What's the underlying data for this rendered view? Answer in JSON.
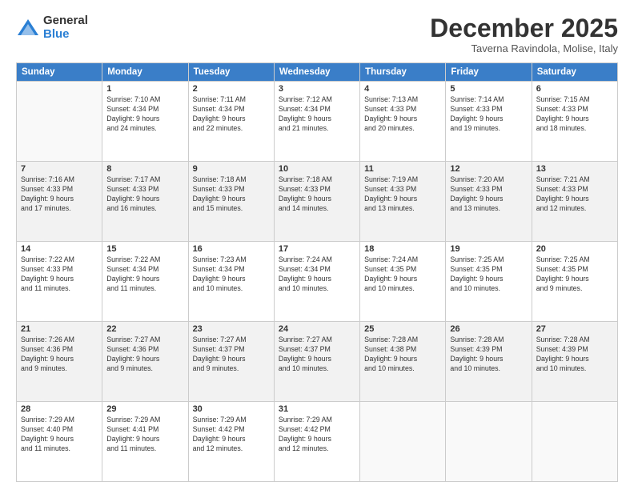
{
  "logo": {
    "general": "General",
    "blue": "Blue"
  },
  "header": {
    "month": "December 2025",
    "location": "Taverna Ravindola, Molise, Italy"
  },
  "weekdays": [
    "Sunday",
    "Monday",
    "Tuesday",
    "Wednesday",
    "Thursday",
    "Friday",
    "Saturday"
  ],
  "weeks": [
    [
      {
        "day": "",
        "info": ""
      },
      {
        "day": "1",
        "info": "Sunrise: 7:10 AM\nSunset: 4:34 PM\nDaylight: 9 hours\nand 24 minutes."
      },
      {
        "day": "2",
        "info": "Sunrise: 7:11 AM\nSunset: 4:34 PM\nDaylight: 9 hours\nand 22 minutes."
      },
      {
        "day": "3",
        "info": "Sunrise: 7:12 AM\nSunset: 4:34 PM\nDaylight: 9 hours\nand 21 minutes."
      },
      {
        "day": "4",
        "info": "Sunrise: 7:13 AM\nSunset: 4:33 PM\nDaylight: 9 hours\nand 20 minutes."
      },
      {
        "day": "5",
        "info": "Sunrise: 7:14 AM\nSunset: 4:33 PM\nDaylight: 9 hours\nand 19 minutes."
      },
      {
        "day": "6",
        "info": "Sunrise: 7:15 AM\nSunset: 4:33 PM\nDaylight: 9 hours\nand 18 minutes."
      }
    ],
    [
      {
        "day": "7",
        "info": "Sunrise: 7:16 AM\nSunset: 4:33 PM\nDaylight: 9 hours\nand 17 minutes."
      },
      {
        "day": "8",
        "info": "Sunrise: 7:17 AM\nSunset: 4:33 PM\nDaylight: 9 hours\nand 16 minutes."
      },
      {
        "day": "9",
        "info": "Sunrise: 7:18 AM\nSunset: 4:33 PM\nDaylight: 9 hours\nand 15 minutes."
      },
      {
        "day": "10",
        "info": "Sunrise: 7:18 AM\nSunset: 4:33 PM\nDaylight: 9 hours\nand 14 minutes."
      },
      {
        "day": "11",
        "info": "Sunrise: 7:19 AM\nSunset: 4:33 PM\nDaylight: 9 hours\nand 13 minutes."
      },
      {
        "day": "12",
        "info": "Sunrise: 7:20 AM\nSunset: 4:33 PM\nDaylight: 9 hours\nand 13 minutes."
      },
      {
        "day": "13",
        "info": "Sunrise: 7:21 AM\nSunset: 4:33 PM\nDaylight: 9 hours\nand 12 minutes."
      }
    ],
    [
      {
        "day": "14",
        "info": "Sunrise: 7:22 AM\nSunset: 4:33 PM\nDaylight: 9 hours\nand 11 minutes."
      },
      {
        "day": "15",
        "info": "Sunrise: 7:22 AM\nSunset: 4:34 PM\nDaylight: 9 hours\nand 11 minutes."
      },
      {
        "day": "16",
        "info": "Sunrise: 7:23 AM\nSunset: 4:34 PM\nDaylight: 9 hours\nand 10 minutes."
      },
      {
        "day": "17",
        "info": "Sunrise: 7:24 AM\nSunset: 4:34 PM\nDaylight: 9 hours\nand 10 minutes."
      },
      {
        "day": "18",
        "info": "Sunrise: 7:24 AM\nSunset: 4:35 PM\nDaylight: 9 hours\nand 10 minutes."
      },
      {
        "day": "19",
        "info": "Sunrise: 7:25 AM\nSunset: 4:35 PM\nDaylight: 9 hours\nand 10 minutes."
      },
      {
        "day": "20",
        "info": "Sunrise: 7:25 AM\nSunset: 4:35 PM\nDaylight: 9 hours\nand 9 minutes."
      }
    ],
    [
      {
        "day": "21",
        "info": "Sunrise: 7:26 AM\nSunset: 4:36 PM\nDaylight: 9 hours\nand 9 minutes."
      },
      {
        "day": "22",
        "info": "Sunrise: 7:27 AM\nSunset: 4:36 PM\nDaylight: 9 hours\nand 9 minutes."
      },
      {
        "day": "23",
        "info": "Sunrise: 7:27 AM\nSunset: 4:37 PM\nDaylight: 9 hours\nand 9 minutes."
      },
      {
        "day": "24",
        "info": "Sunrise: 7:27 AM\nSunset: 4:37 PM\nDaylight: 9 hours\nand 10 minutes."
      },
      {
        "day": "25",
        "info": "Sunrise: 7:28 AM\nSunset: 4:38 PM\nDaylight: 9 hours\nand 10 minutes."
      },
      {
        "day": "26",
        "info": "Sunrise: 7:28 AM\nSunset: 4:39 PM\nDaylight: 9 hours\nand 10 minutes."
      },
      {
        "day": "27",
        "info": "Sunrise: 7:28 AM\nSunset: 4:39 PM\nDaylight: 9 hours\nand 10 minutes."
      }
    ],
    [
      {
        "day": "28",
        "info": "Sunrise: 7:29 AM\nSunset: 4:40 PM\nDaylight: 9 hours\nand 11 minutes."
      },
      {
        "day": "29",
        "info": "Sunrise: 7:29 AM\nSunset: 4:41 PM\nDaylight: 9 hours\nand 11 minutes."
      },
      {
        "day": "30",
        "info": "Sunrise: 7:29 AM\nSunset: 4:42 PM\nDaylight: 9 hours\nand 12 minutes."
      },
      {
        "day": "31",
        "info": "Sunrise: 7:29 AM\nSunset: 4:42 PM\nDaylight: 9 hours\nand 12 minutes."
      },
      {
        "day": "",
        "info": ""
      },
      {
        "day": "",
        "info": ""
      },
      {
        "day": "",
        "info": ""
      }
    ]
  ]
}
